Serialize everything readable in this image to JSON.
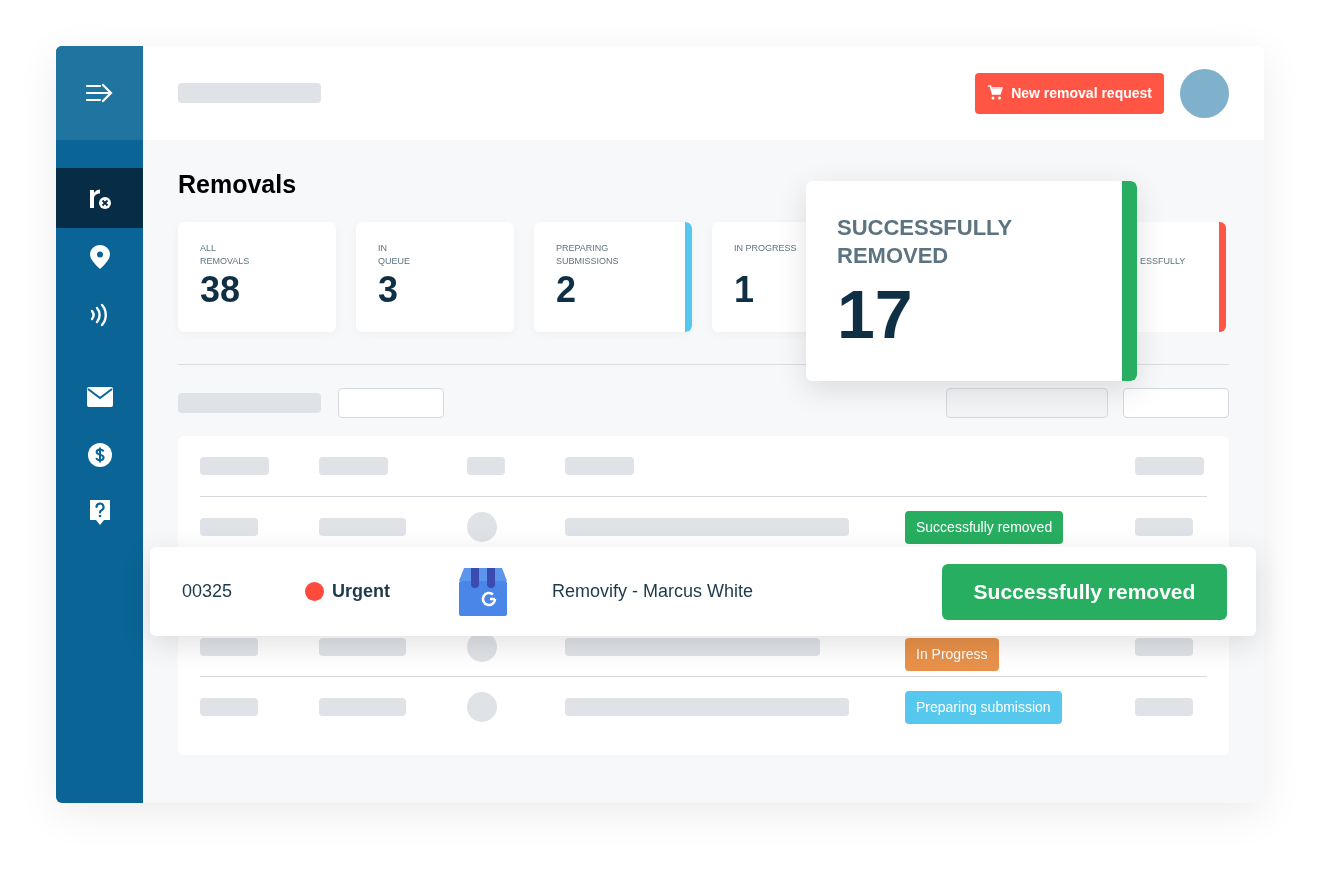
{
  "header": {
    "new_request_button": "New removal request"
  },
  "sidebar": {
    "items": [
      {
        "kind": "logo",
        "selected": true
      },
      {
        "kind": "pin",
        "selected": false
      },
      {
        "kind": "contactless",
        "selected": false
      },
      {
        "kind": "mail",
        "selected": false
      },
      {
        "kind": "dollar",
        "selected": false
      },
      {
        "kind": "help",
        "selected": false
      }
    ]
  },
  "page_title": "Removals",
  "stat_cards": [
    {
      "label": "ALL\nREMOVALS",
      "value": "38"
    },
    {
      "label": "IN\nQUEUE",
      "value": "3"
    },
    {
      "label": "PREPARING\nSUBMISSIONS",
      "value": "2",
      "color": "#56c8ee"
    },
    {
      "label": "IN PROGRESS",
      "value": "1"
    }
  ],
  "partial_card": {
    "label": "ESSFULLY",
    "color": "#ff5544"
  },
  "featured_card": {
    "label": "SUCCESSFULLY\nREMOVED",
    "value": "17",
    "color": "#27ae60"
  },
  "table": {
    "rows": [
      {
        "status": "Successfully removed",
        "color": "#27ae60"
      },
      {
        "status": "In Progress",
        "color": "#e8914a"
      },
      {
        "status": "Preparing submission",
        "color": "#56c8ee"
      }
    ]
  },
  "highlighted_row": {
    "id": "00325",
    "priority": {
      "label": "Urgent",
      "color": "#ff4b3e"
    },
    "name": "Removify - Marcus White",
    "status": {
      "label": "Successfully removed",
      "color": "#27ae60"
    }
  }
}
